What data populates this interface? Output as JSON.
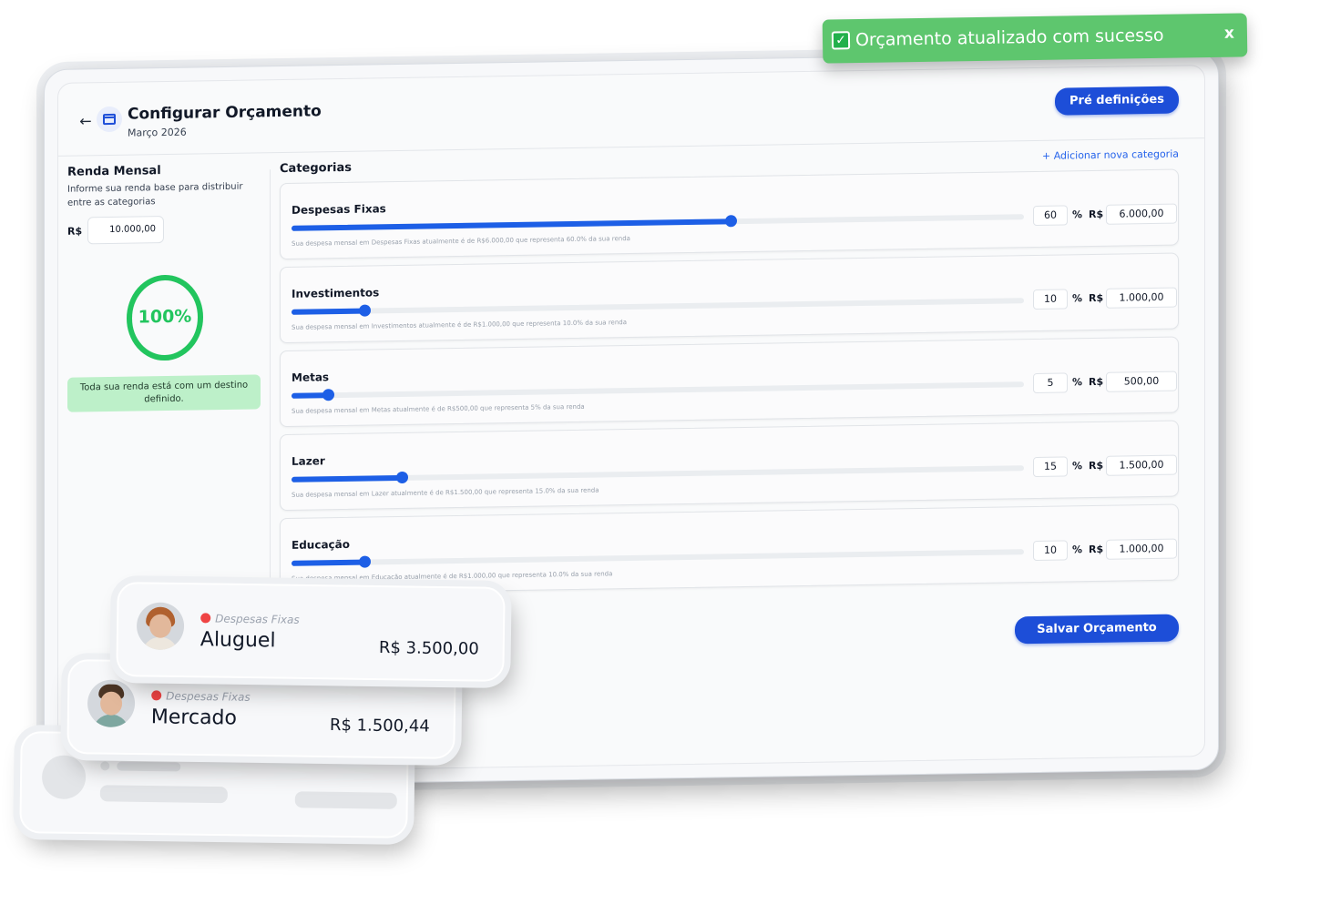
{
  "toast": {
    "message": "Orçamento atualizado com sucesso",
    "close_label": "x",
    "color": "#5ec66e"
  },
  "header": {
    "title": "Configurar Orçamento",
    "subtitle": "Março 2026",
    "back_icon": "arrow-left-icon",
    "calendar_icon": "calendar-icon",
    "predefinitions_label": "Pré definições"
  },
  "income": {
    "title": "Renda Mensal",
    "description": "Informe sua renda base para distribuir entre as categorias",
    "currency": "R$",
    "value": "10.000,00",
    "progress_label": "100%",
    "progress_fraction": 1.0,
    "status_message": "Toda sua renda está com um destino definido."
  },
  "categories": {
    "title": "Categorias",
    "add_label": "+ Adicionar nova categoria",
    "items": [
      {
        "name": "Despesas Fixas",
        "percent": 60,
        "percent_label": "60",
        "amount": "6.000,00",
        "note": "Sua despesa mensal em Despesas Fixas atualmente é de R$6.000,00 que representa 60.0% da sua renda"
      },
      {
        "name": "Investimentos",
        "percent": 10,
        "percent_label": "10",
        "amount": "1.000,00",
        "note": "Sua despesa mensal em Investimentos atualmente é de R$1.000,00 que representa 10.0% da sua renda"
      },
      {
        "name": "Metas",
        "percent": 5,
        "percent_label": "5",
        "amount": "500,00",
        "note": "Sua despesa mensal em Metas atualmente é de R$500,00 que representa 5% da sua renda"
      },
      {
        "name": "Lazer",
        "percent": 15,
        "percent_label": "15",
        "amount": "1.500,00",
        "note": "Sua despesa mensal em Lazer atualmente é de R$1.500,00 que representa 15.0% da sua renda"
      },
      {
        "name": "Educação",
        "percent": 10,
        "percent_label": "10",
        "amount": "1.000,00",
        "note": "Sua despesa mensal em Educação atualmente é de R$1.000,00 que representa 10.0% da sua renda"
      }
    ],
    "percent_symbol": "%",
    "currency_symbol": "R$",
    "save_label": "Salvar Orçamento"
  },
  "transactions": [
    {
      "category": "Despesas Fixas",
      "name": "Aluguel",
      "amount": "R$ 3.500,00"
    },
    {
      "category": "Despesas Fixas",
      "name": "Mercado",
      "amount": "R$ 1.500,44"
    }
  ],
  "colors": {
    "accent": "#1d4ed8",
    "slider": "#1d5fe6",
    "success": "#22c55e",
    "success_box": "#bdf0c9"
  }
}
